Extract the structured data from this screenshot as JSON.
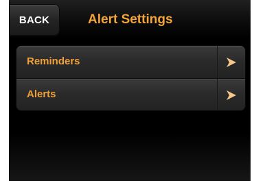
{
  "header": {
    "back_label": "BACK",
    "title": "Alert Settings"
  },
  "menu": {
    "items": [
      {
        "label": "Reminders",
        "icon": "chevron-right-icon"
      },
      {
        "label": "Alerts",
        "icon": "chevron-right-icon"
      }
    ]
  },
  "colors": {
    "accent": "#f3a43a",
    "background": "#000000",
    "row": "#2a2a2a"
  }
}
